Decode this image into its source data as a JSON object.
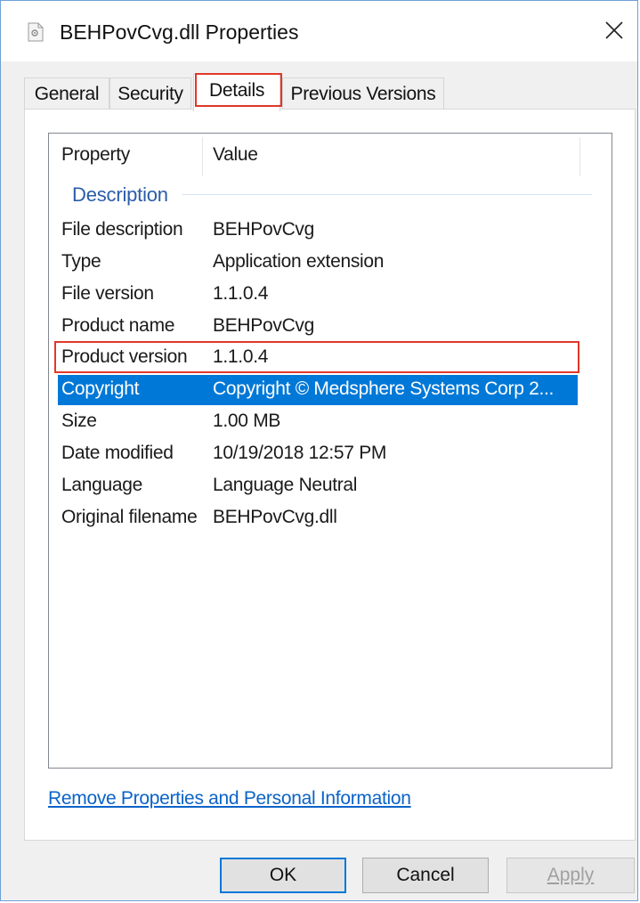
{
  "window": {
    "title": "BEHPovCvg.dll Properties",
    "accent": "#0078d7",
    "highlight_color": "#e0372b"
  },
  "tabs": [
    {
      "label": "General",
      "active": false
    },
    {
      "label": "Security",
      "active": false
    },
    {
      "label": "Details",
      "active": true
    },
    {
      "label": "Previous Versions",
      "active": false
    }
  ],
  "details": {
    "columns": {
      "property": "Property",
      "value": "Value"
    },
    "group": "Description",
    "rows": [
      {
        "property": "File description",
        "value": "BEHPovCvg"
      },
      {
        "property": "Type",
        "value": "Application extension"
      },
      {
        "property": "File version",
        "value": "1.1.0.4"
      },
      {
        "property": "Product name",
        "value": "BEHPovCvg"
      },
      {
        "property": "Product version",
        "value": "1.1.0.4"
      },
      {
        "property": "Copyright",
        "value": "Copyright © Medsphere Systems Corp 2..."
      },
      {
        "property": "Size",
        "value": "1.00 MB"
      },
      {
        "property": "Date modified",
        "value": "10/19/2018 12:57 PM"
      },
      {
        "property": "Language",
        "value": "Language Neutral"
      },
      {
        "property": "Original filename",
        "value": "BEHPovCvg.dll"
      }
    ],
    "selected_row": "Copyright",
    "highlighted_row": "Product version"
  },
  "link": {
    "label": "Remove Properties and Personal Information"
  },
  "buttons": {
    "ok": "OK",
    "cancel": "Cancel",
    "apply": "Apply"
  }
}
